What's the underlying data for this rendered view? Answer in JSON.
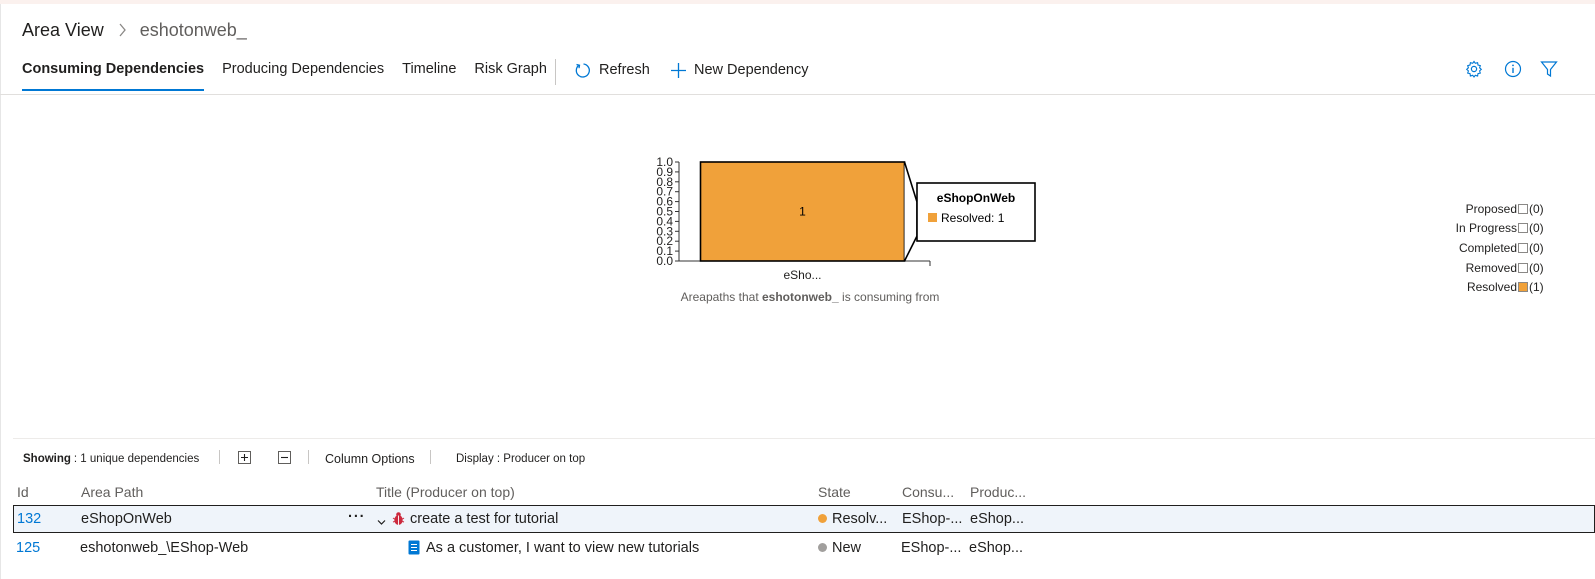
{
  "breadcrumb": {
    "root": "Area View",
    "current": "eshotonweb_"
  },
  "tabs": [
    {
      "label": "Consuming Dependencies",
      "active": true
    },
    {
      "label": "Producing Dependencies",
      "active": false
    },
    {
      "label": "Timeline",
      "active": false
    },
    {
      "label": "Risk Graph",
      "active": false
    }
  ],
  "commands": {
    "refresh": "Refresh",
    "new_dependency": "New Dependency"
  },
  "icons": [
    "chevron-right-icon",
    "refresh-icon",
    "plus-icon",
    "gear-icon",
    "info-icon",
    "filter-icon",
    "ellipsis-icon",
    "chevron-down-icon",
    "bug-icon",
    "user-story-icon"
  ],
  "colors": {
    "accent": "#0078d4",
    "resolved": "#f0a13a",
    "new": "#a19f9d"
  },
  "chart_data": {
    "type": "bar",
    "categories": [
      "eSho..."
    ],
    "series": [
      {
        "name": "Resolved",
        "values": [
          1
        ]
      }
    ],
    "data_labels": [
      "1"
    ],
    "ylim": [
      0,
      1.0
    ],
    "yticks": [
      "1.0",
      "0.9",
      "0.8",
      "0.7",
      "0.6",
      "0.5",
      "0.4",
      "0.3",
      "0.2",
      "0.1",
      "0.0"
    ],
    "tooltip": {
      "title": "eShopOnWeb",
      "entry": "Resolved: 1"
    },
    "caption_prefix": "Areapaths that",
    "caption_bold": "eshotonweb_",
    "caption_suffix": "is consuming from",
    "legend": [
      {
        "label": "Proposed",
        "count": "(0)",
        "color": "#ffffff"
      },
      {
        "label": "In Progress",
        "count": "(0)",
        "color": "#ffffff"
      },
      {
        "label": "Completed",
        "count": "(0)",
        "color": "#ffffff"
      },
      {
        "label": "Removed",
        "count": "(0)",
        "color": "#ffffff"
      },
      {
        "label": "Resolved",
        "count": "(1)",
        "color": "#f0a13a"
      }
    ]
  },
  "grid_toolbar": {
    "showing_label": "Showing",
    "showing_value": ": 1 unique dependencies",
    "column_options": "Column Options",
    "display": "Display : Producer on top"
  },
  "grid": {
    "headers": {
      "id": "Id",
      "area_path": "Area Path",
      "title": "Title (Producer on top)",
      "state": "State",
      "consumer": "Consu...",
      "producer": "Produc..."
    },
    "rows": [
      {
        "id": "132",
        "area_path": "eShopOnWeb",
        "title": "create a test for tutorial",
        "state": "Resolv...",
        "consumer": "EShop-...",
        "producer": "eShop..."
      },
      {
        "id": "125",
        "area_path": "eshotonweb_\\EShop-Web",
        "title": "As a customer, I want to view new tutorials",
        "state": "New",
        "consumer": "EShop-...",
        "producer": "eShop..."
      }
    ]
  }
}
